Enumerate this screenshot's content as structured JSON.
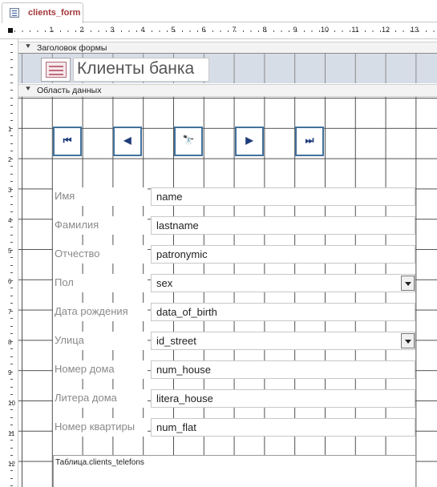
{
  "tab": {
    "title": "clients_form",
    "icon": "form-icon"
  },
  "ruler": {
    "h_numbers": [
      "1",
      "2",
      "3",
      "4",
      "5",
      "6",
      "7",
      "8",
      "9",
      "10",
      "11",
      "12",
      "13"
    ],
    "v_numbers": [
      "1",
      "2",
      "3",
      "4",
      "5",
      "6",
      "7",
      "8",
      "9",
      "10",
      "11",
      "12"
    ]
  },
  "sections": {
    "header": "Заголовок формы",
    "detail": "Область данных"
  },
  "form": {
    "title": "Клиенты банка",
    "logo": "form-logo-icon"
  },
  "nav_buttons": [
    {
      "name": "first-record-button",
      "glyph": "⏮",
      "icon": "first-record-icon"
    },
    {
      "name": "previous-record-button",
      "glyph": "◀",
      "icon": "previous-record-icon"
    },
    {
      "name": "find-record-button",
      "glyph": "🔭",
      "icon": "binoculars-icon"
    },
    {
      "name": "next-record-button",
      "glyph": "▶",
      "icon": "next-record-icon"
    },
    {
      "name": "last-record-button",
      "glyph": "⏭",
      "icon": "last-record-icon"
    }
  ],
  "fields": [
    {
      "label": "Имя",
      "value": "name",
      "combo": false
    },
    {
      "label": "Фамилия",
      "value": "lastname",
      "combo": false
    },
    {
      "label": "Отчество",
      "value": "patronymic",
      "combo": false
    },
    {
      "label": "Пол",
      "value": "sex",
      "combo": true
    },
    {
      "label": "Дата рождения",
      "value": "data_of_birth",
      "combo": false
    },
    {
      "label": "Улица",
      "value": "id_street",
      "combo": true
    },
    {
      "label": "Номер дома",
      "value": "num_house",
      "combo": false
    },
    {
      "label": "Литера дома",
      "value": "litera_house",
      "combo": false
    },
    {
      "label": "Номер квартиры",
      "value": "num_flat",
      "combo": false
    }
  ],
  "subform": {
    "label": "Таблица.clients_telefons"
  }
}
